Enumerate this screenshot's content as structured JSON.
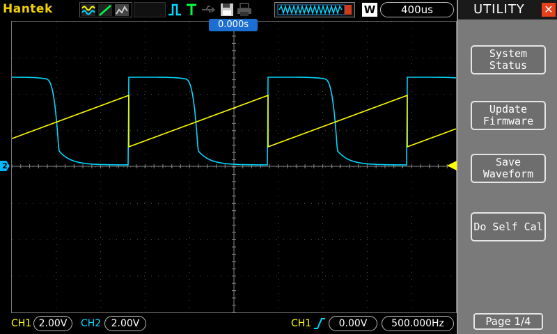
{
  "header": {
    "brand": "Hantek",
    "timebase": "400us",
    "waveform_mode": "W",
    "trigger_position": "0.000s"
  },
  "panel": {
    "title": "UTILITY",
    "buttons": [
      {
        "label": "System\nStatus"
      },
      {
        "label": "Update\nFirmware"
      },
      {
        "label": "Save\nWaveform"
      },
      {
        "label": "Do Self Cal"
      }
    ],
    "page": "Page 1/4"
  },
  "footer": {
    "ch1_label": "CH1",
    "ch1_scale": "2.00V",
    "ch2_label": "CH2",
    "ch2_scale": "2.00V",
    "trig_source": "CH1",
    "trig_level": "0.00V",
    "trig_freq": "500.000Hz"
  },
  "markers": {
    "ch2_marker": "2"
  },
  "colors": {
    "ch1": "#ffff00",
    "ch2": "#00d8ff",
    "brand": "#f0d000",
    "close": "#e8401a"
  },
  "icons": {
    "mode_wave": "wave-icon",
    "mode_ramp": "ramp-icon",
    "mode_persist": "persist-icon",
    "trigger_edge": "trigger-edge-icon",
    "trigger_t": "trigger-t-icon",
    "usb": "usb-icon",
    "save": "floppy-icon",
    "print": "printer-icon",
    "close": "close-icon"
  }
}
